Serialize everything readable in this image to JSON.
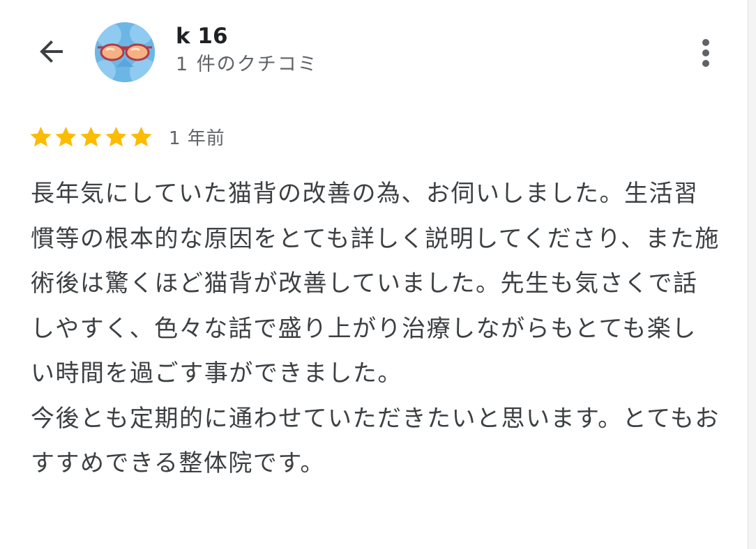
{
  "header": {
    "back_icon": "arrow-left-icon",
    "avatar_icon": "sunglasses-avatar",
    "user_name": "k 16",
    "review_count": "1 件のクチコミ",
    "more_icon": "more-vert-icon"
  },
  "review": {
    "stars": 5,
    "star_color": "#fbbc04",
    "date": "1 年前",
    "text": "長年気にしていた猫背の改善の為、お伺いしました。生活習慣等の根本的な原因をとても詳しく説明してくださり、また施術後は驚くほど猫背が改善していました。先生も気さくで話しやすく、色々な話で盛り上がり治療しながらもとても楽しい時間を過ごす事ができました。\n今後とも定期的に通わせていただきたいと思います。とてもおすすめできる整体院です。"
  }
}
